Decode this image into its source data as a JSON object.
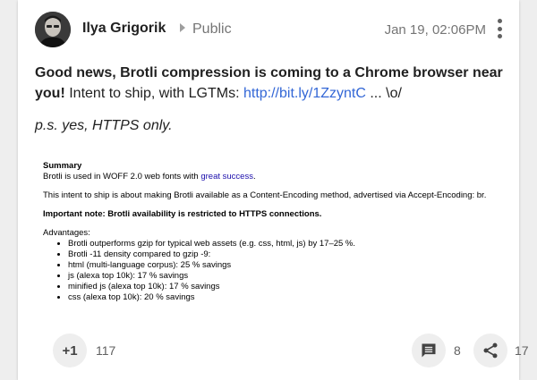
{
  "author": {
    "name": "Ilya Grigorik",
    "visibility": "Public",
    "timestamp": "Jan 19, 02:06PM"
  },
  "post": {
    "headline": "Good news, Brotli compression is coming to a Chrome browser near you!",
    "intro": " Intent to ship, with LGTMs: ",
    "link": "http://bit.ly/1ZzyntC",
    "suffix": " ... \\o/",
    "ps": "p.s. yes, HTTPS only."
  },
  "attachment": {
    "summary_title": "Summary",
    "summary_text": "Brotli is used in WOFF 2.0 web fonts with ",
    "summary_link": "great success",
    "summary_end": ".",
    "intent": "This intent to ship is about making Brotli available as a Content-Encoding method, advertised via Accept-Encoding: br.",
    "note": "Important note: Brotli availability is restricted to HTTPS connections.",
    "advantages_title": "Advantages:",
    "advantages": [
      "Brotli outperforms gzip for typical web assets (e.g. css, html, js) by 17–25 %.",
      "Brotli -11 density compared to gzip -9:",
      "html (multi-language corpus): 25 % savings",
      "js (alexa top 10k): 17 % savings",
      "minified js (alexa top 10k): 17 % savings",
      "css (alexa top 10k): 20 % savings"
    ]
  },
  "actions": {
    "plus_one_label": "+1",
    "plus_one_count": "117",
    "comment_icon": "comment-icon",
    "comment_count": "8",
    "share_icon": "share-icon",
    "share_count": "17"
  }
}
